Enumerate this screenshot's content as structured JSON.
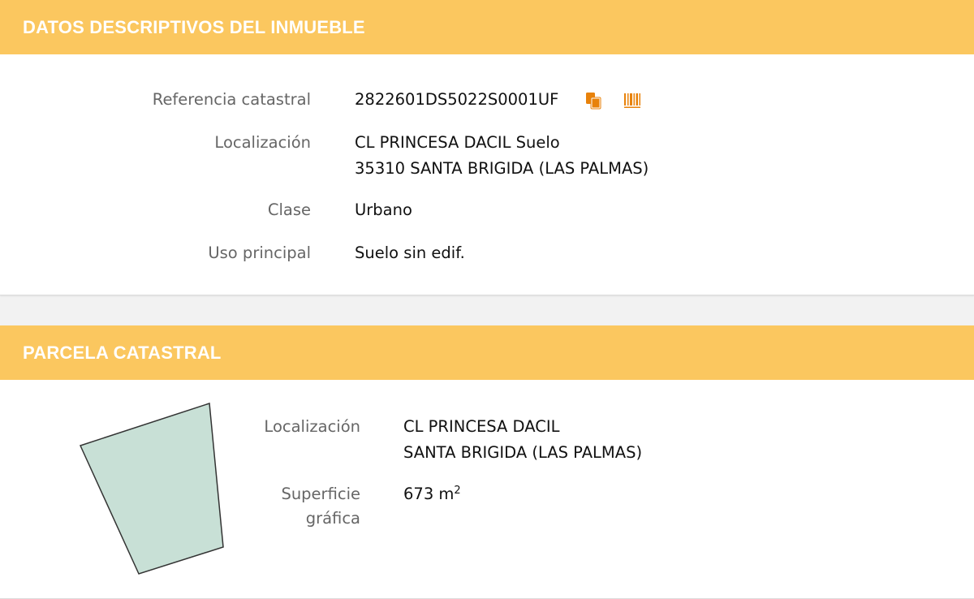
{
  "section1": {
    "title": "DATOS DESCRIPTIVOS DEL INMUEBLE",
    "rows": [
      {
        "label": "Referencia catastral",
        "value": "2822601DS5022S0001UF"
      },
      {
        "label": "Localización",
        "value_line1": "CL PRINCESA DACIL Suelo",
        "value_line2": "35310 SANTA BRIGIDA (LAS PALMAS)"
      },
      {
        "label": "Clase",
        "value": "Urbano"
      },
      {
        "label": "Uso principal",
        "value": "Suelo sin edif."
      }
    ],
    "icons": [
      "copy-icon",
      "barcode-icon"
    ],
    "accent_color": "#e8820a"
  },
  "section2": {
    "title": "PARCELA CATASTRAL",
    "localizacion": {
      "label": "Localización",
      "line1": "CL PRINCESA DACIL",
      "line2": "SANTA BRIGIDA (LAS PALMAS)"
    },
    "superficie": {
      "label_line1": "Superficie",
      "label_line2": "gráfica",
      "value": "673 m",
      "unit_sup": "2"
    },
    "parcel_fill": "#c8e0d6"
  },
  "header_color": "#fbc75f"
}
